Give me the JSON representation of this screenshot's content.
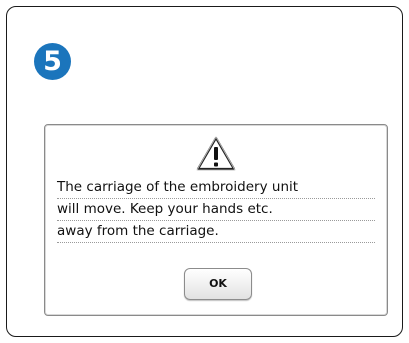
{
  "step": {
    "number": "5",
    "color": "#1b75bc"
  },
  "dialog": {
    "icon": "warning-triangle-icon",
    "message_lines": [
      "The carriage of the embroidery unit",
      "will move. Keep your hands etc.",
      "away from the carriage."
    ],
    "ok_label": "OK"
  }
}
